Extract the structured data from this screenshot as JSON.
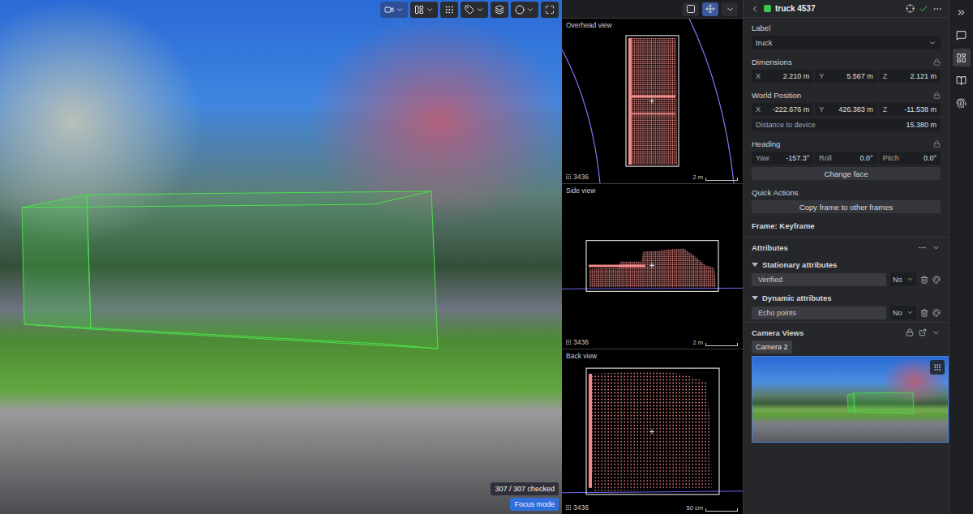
{
  "image_toolbar": [
    {
      "selected": true,
      "menu": true
    },
    {
      "selected": false,
      "menu": true
    },
    {
      "selected": false,
      "menu": false
    },
    {
      "selected": false,
      "menu": true
    },
    {
      "selected": false,
      "menu": false
    },
    {
      "selected": false,
      "menu": true
    },
    {
      "selected": false,
      "menu": false
    }
  ],
  "badges": {
    "checked": "307 / 307 checked",
    "focus_mode": "Focus mode"
  },
  "views_toolbar": [
    {
      "selected": false,
      "menu": false
    },
    {
      "selected": true,
      "menu": false
    },
    {
      "selected": false,
      "menu": true
    }
  ],
  "views": [
    {
      "title": "Overhead view",
      "points": "3436",
      "scale": "2 m"
    },
    {
      "title": "Side view",
      "points": "3436",
      "scale": "2 m"
    },
    {
      "title": "Back view",
      "points": "3436",
      "scale": "50 cm"
    }
  ],
  "object": {
    "title": "truck 4537",
    "color": "#3fc34f"
  },
  "label": {
    "heading": "Label",
    "value": "truck"
  },
  "dimensions": {
    "heading": "Dimensions",
    "locked": true,
    "fields": [
      {
        "axis": "X",
        "value": "2.210 m"
      },
      {
        "axis": "Y",
        "value": "5.567 m"
      },
      {
        "axis": "Z",
        "value": "2.121 m"
      }
    ]
  },
  "world_position": {
    "heading": "World Position",
    "locked": true,
    "fields": [
      {
        "axis": "X",
        "value": "-222.676 m"
      },
      {
        "axis": "Y",
        "value": "426.383 m"
      },
      {
        "axis": "Z",
        "value": "-11.538 m"
      }
    ],
    "distance": {
      "label": "Distance to device",
      "value": "15.380 m"
    }
  },
  "heading": {
    "heading": "Heading",
    "locked": true,
    "fields": [
      {
        "axis": "Yaw",
        "value": "-157.3°"
      },
      {
        "axis": "Roll",
        "value": "0.0°"
      },
      {
        "axis": "Pitch",
        "value": "0.0°"
      }
    ],
    "button": "Change face"
  },
  "quick_actions": {
    "heading": "Quick Actions",
    "button": "Copy frame to other frames"
  },
  "frame": "Frame: Keyframe",
  "attributes": {
    "heading": "Attributes",
    "expanded": true,
    "groups": [
      {
        "title": "Stationary attributes",
        "expanded": true,
        "items": [
          {
            "name": "Verified",
            "value": "No"
          }
        ]
      },
      {
        "title": "Dynamic attributes",
        "expanded": true,
        "items": [
          {
            "name": "Echo points",
            "value": "No"
          }
        ]
      }
    ]
  },
  "camera_views": {
    "heading": "Camera Views",
    "expanded": true,
    "tabs": [
      {
        "label": "Camera 2",
        "selected": true
      }
    ]
  },
  "rail": [
    {
      "selected": false
    },
    {
      "selected": true
    },
    {
      "selected": false
    },
    {
      "selected": false
    }
  ]
}
